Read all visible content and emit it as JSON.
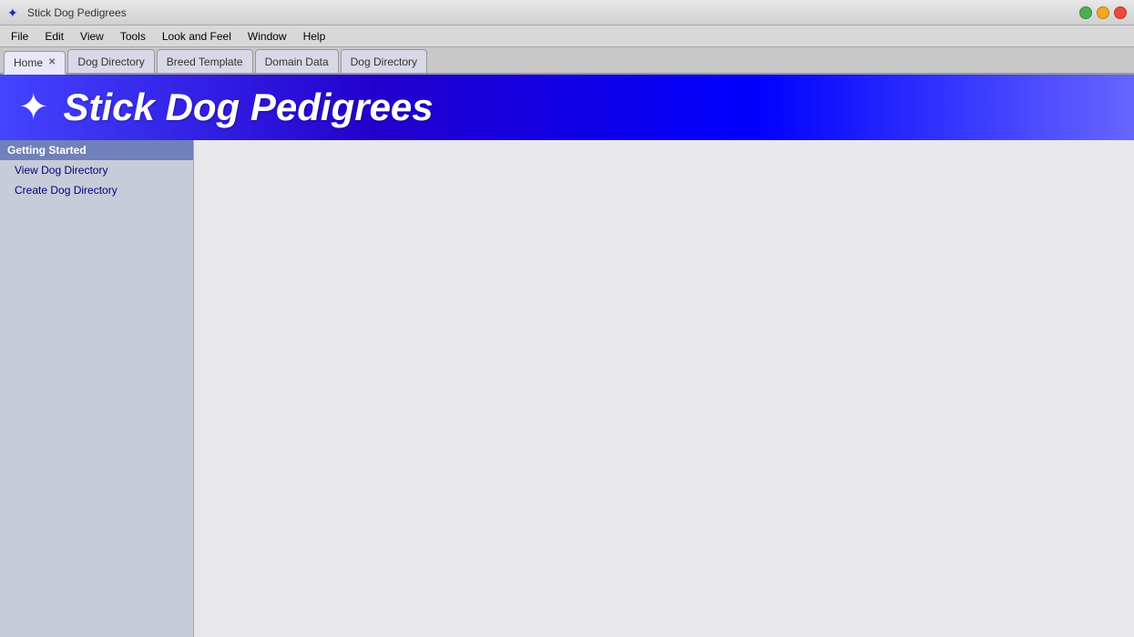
{
  "titlebar": {
    "title": "Stick Dog Pedigrees",
    "icon": "✦"
  },
  "menubar": {
    "items": [
      {
        "id": "file",
        "label": "File"
      },
      {
        "id": "edit",
        "label": "Edit"
      },
      {
        "id": "view",
        "label": "View"
      },
      {
        "id": "tools",
        "label": "Tools"
      },
      {
        "id": "look-and-feel",
        "label": "Look and Feel"
      },
      {
        "id": "window",
        "label": "Window"
      },
      {
        "id": "help",
        "label": "Help"
      }
    ]
  },
  "tabs": [
    {
      "id": "home",
      "label": "Home",
      "closable": true,
      "active": true
    },
    {
      "id": "dog-directory-1",
      "label": "Dog Directory",
      "closable": false,
      "active": false
    },
    {
      "id": "breed-template",
      "label": "Breed Template",
      "closable": false,
      "active": false
    },
    {
      "id": "domain-data",
      "label": "Domain Data",
      "closable": false,
      "active": false
    },
    {
      "id": "dog-directory-2",
      "label": "Dog Directory",
      "closable": false,
      "active": false
    }
  ],
  "banner": {
    "icon": "✦",
    "title": "Stick Dog Pedigrees"
  },
  "sidebar": {
    "section": "Getting Started",
    "links": [
      {
        "id": "view-dog-directory",
        "label": "View Dog Directory"
      },
      {
        "id": "create-dog-directory",
        "label": "Create Dog Directory"
      }
    ]
  },
  "windowControls": {
    "green_label": "maximize",
    "yellow_label": "minimize",
    "red_label": "close"
  }
}
